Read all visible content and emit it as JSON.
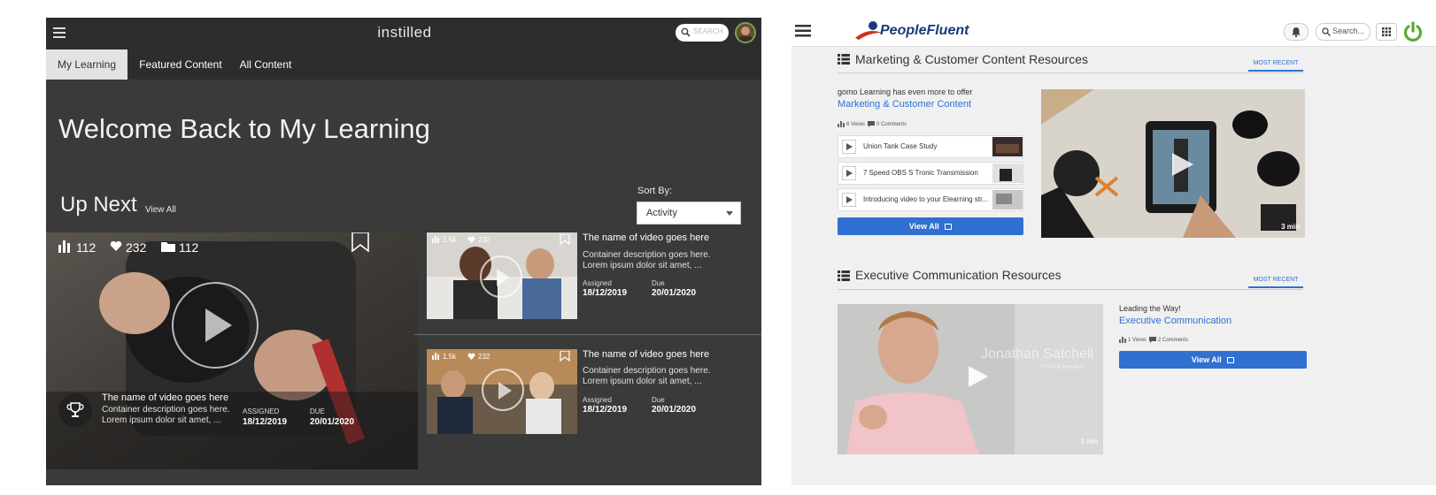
{
  "instilled": {
    "brand": "instilled",
    "search_placeholder": "SEARCH",
    "tabs": [
      "My Learning",
      "Featured Content",
      "All Content"
    ],
    "welcome": "Welcome Back to My Learning",
    "up_next": "Up Next",
    "view_all": "View All",
    "sort_by_label": "Sort By:",
    "sort_value": "Activity",
    "featured": {
      "views": "112",
      "likes": "232",
      "folders": "112",
      "title": "The name of video goes here",
      "desc1": "Container description goes here.",
      "desc2": "Lorem ipsum dolor sit amet, ...",
      "assigned_label": "ASSIGNED",
      "assigned": "18/12/2019",
      "due_label": "DUE",
      "due": "20/01/2020"
    },
    "cards": [
      {
        "views": "1.5k",
        "likes": "232",
        "title": "The name of video goes here",
        "desc1": "Container description goes here.",
        "desc2": "Lorem ipsum dolor sit amet, ...",
        "assigned_label": "Assigned",
        "assigned": "18/12/2019",
        "due_label": "Due",
        "due": "20/01/2020"
      },
      {
        "views": "1.5k",
        "likes": "232",
        "title": "The name of video goes here",
        "desc1": "Container description goes here.",
        "desc2": "Lorem ipsum dolor sit amet, ...",
        "assigned_label": "Assigned",
        "assigned": "18/12/2019",
        "due_label": "Due",
        "due": "20/01/2020"
      }
    ]
  },
  "peoplefluent": {
    "brand": "PeopleFluent",
    "search_placeholder": "Search...",
    "sections": [
      {
        "title": "Marketing & Customer Content Resources",
        "tab": "MOST RECENT",
        "intro": "gomo Learning has even more to offer",
        "link": "Marketing & Customer Content",
        "views": "6 Views",
        "comments": "0 Comments",
        "items": [
          "Union Tank Case Study",
          "7 Speed OBS S Tronic Transmission",
          "Introducing video to your Elearning str..."
        ],
        "view_all": "View All",
        "duration": "3 min"
      },
      {
        "title": "Executive Communication Resources",
        "tab": "MOST RECENT",
        "intro": "Leading the Way!",
        "link": "Executive Communication",
        "views": "1 Views",
        "comments": "2 Comments",
        "view_all": "View All",
        "overlay_name": "Jonathan Satchell",
        "overlay_role": "Chief Executive",
        "duration": "1 min"
      }
    ]
  },
  "colors": {
    "instilled_bg": "#3a3a3a",
    "pf_blue": "#2f70d0",
    "pf_navy": "#1a3a78",
    "pf_red": "#d03020"
  },
  "icons": [
    "menu-icon",
    "search-icon",
    "avatar",
    "bookmark-icon",
    "play-icon",
    "trophy-icon",
    "bar-chart-icon",
    "heart-icon",
    "folder-icon",
    "list-icon",
    "bell-icon",
    "grid-icon",
    "power-icon",
    "comment-icon",
    "external-link-icon"
  ]
}
